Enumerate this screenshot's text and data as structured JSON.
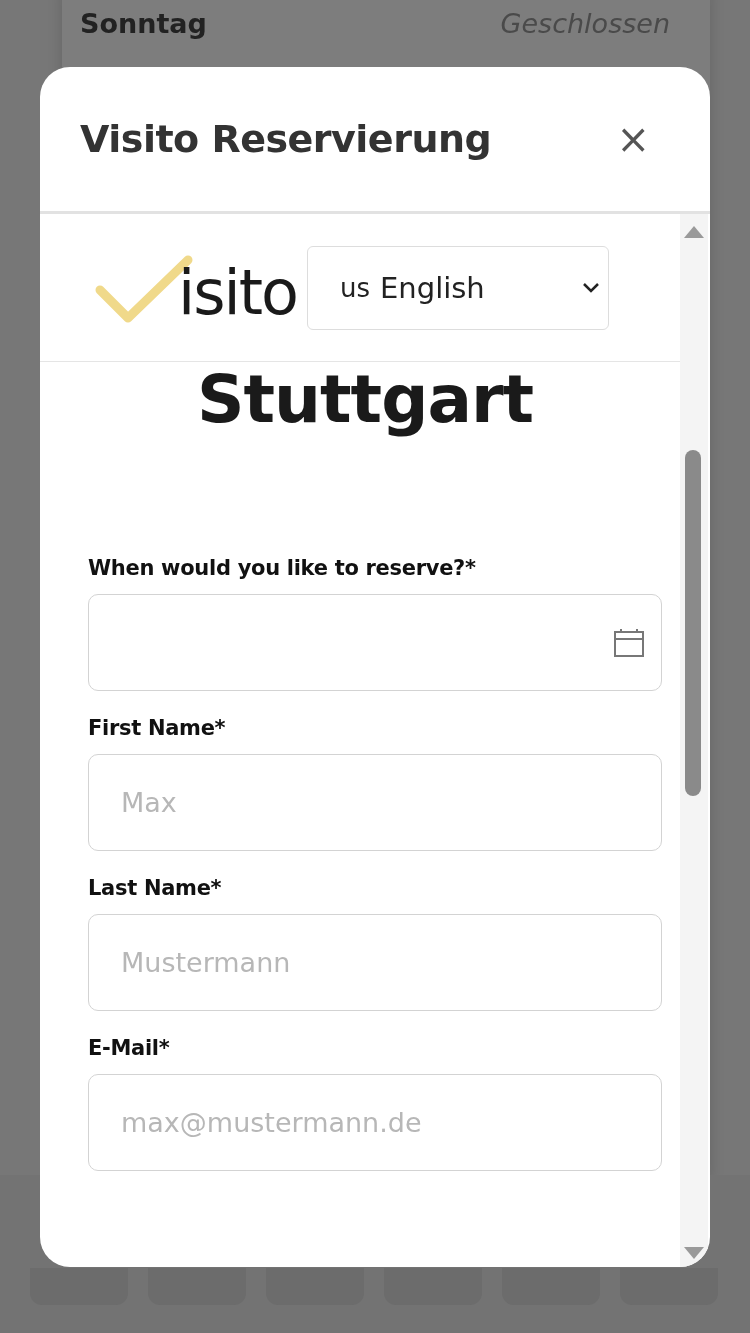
{
  "background": {
    "day": "Sonntag",
    "hours": "Geschlossen"
  },
  "dialog": {
    "title": "Visito Reservierung",
    "close": "×"
  },
  "logo": {
    "text": "isito"
  },
  "language": {
    "flag": "us",
    "value": "English"
  },
  "venue": "Stuttgart",
  "fields": [
    {
      "kind": "date",
      "label": "When would you like to reserve?*"
    },
    {
      "kind": "text",
      "label": "First Name*",
      "placeholder": "Max"
    },
    {
      "kind": "text",
      "label": "Last Name*",
      "placeholder": "Mustermann"
    },
    {
      "kind": "text",
      "label": "E-Mail*",
      "placeholder": "max@mustermann.de"
    }
  ]
}
